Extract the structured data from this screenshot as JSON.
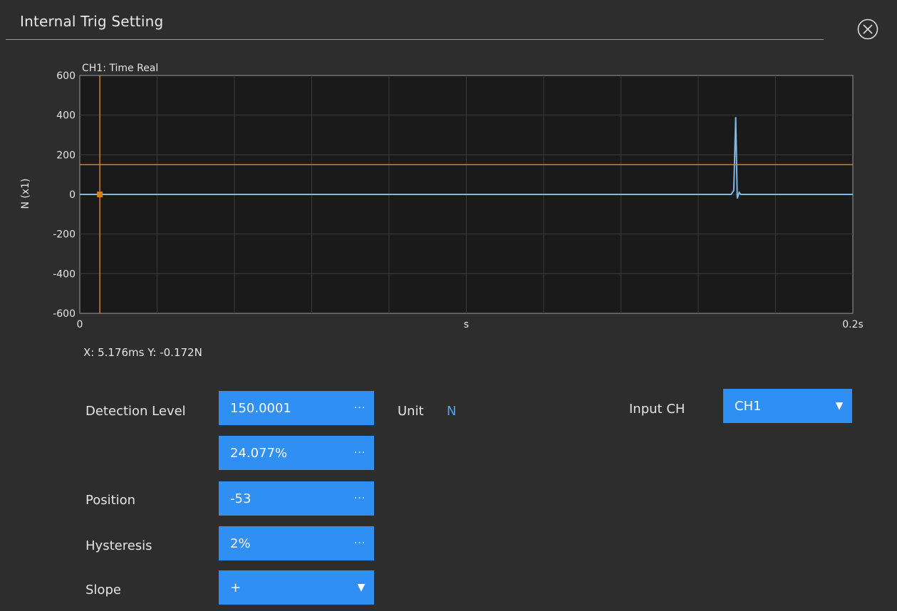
{
  "dialog": {
    "title": "Internal Trig Setting",
    "close_icon": "close-circle-icon"
  },
  "chart_data": {
    "type": "line",
    "title": "CH1: Time Real",
    "ylabel": "N (x1)",
    "xlabel": "s",
    "xlim": [
      0,
      0.2
    ],
    "ylim": [
      -600,
      600
    ],
    "x_tick_labels": [
      "0",
      "s",
      "0.2s"
    ],
    "y_ticks": [
      600,
      400,
      200,
      0,
      -200,
      -400,
      -600
    ],
    "grid": true,
    "series": [
      {
        "color": "#7db8e8",
        "points": [
          [
            0,
            0
          ],
          [
            0.1685,
            0
          ],
          [
            0.1692,
            20
          ],
          [
            0.1697,
            390
          ],
          [
            0.1701,
            -20
          ],
          [
            0.1706,
            10
          ],
          [
            0.171,
            0
          ],
          [
            0.2,
            0
          ]
        ]
      }
    ],
    "trigger_level": 150,
    "cursor_x": 0.005176,
    "trigger_color": "#e07b1a"
  },
  "readout": "X: 5.176ms Y: -0.172N",
  "settings": {
    "detection_level_label": "Detection Level",
    "detection_level_value": "150.0001",
    "detection_percent_value": "24.077%",
    "unit_label": "Unit",
    "unit_value": "N",
    "position_label": "Position",
    "position_value": "-53",
    "hysteresis_label": "Hysteresis",
    "hysteresis_value": "2%",
    "slope_label": "Slope",
    "slope_value": "+",
    "input_ch_label": "Input CH",
    "input_ch_value": "CH1",
    "more_glyph": "···",
    "dropdown_glyph": "▼"
  }
}
